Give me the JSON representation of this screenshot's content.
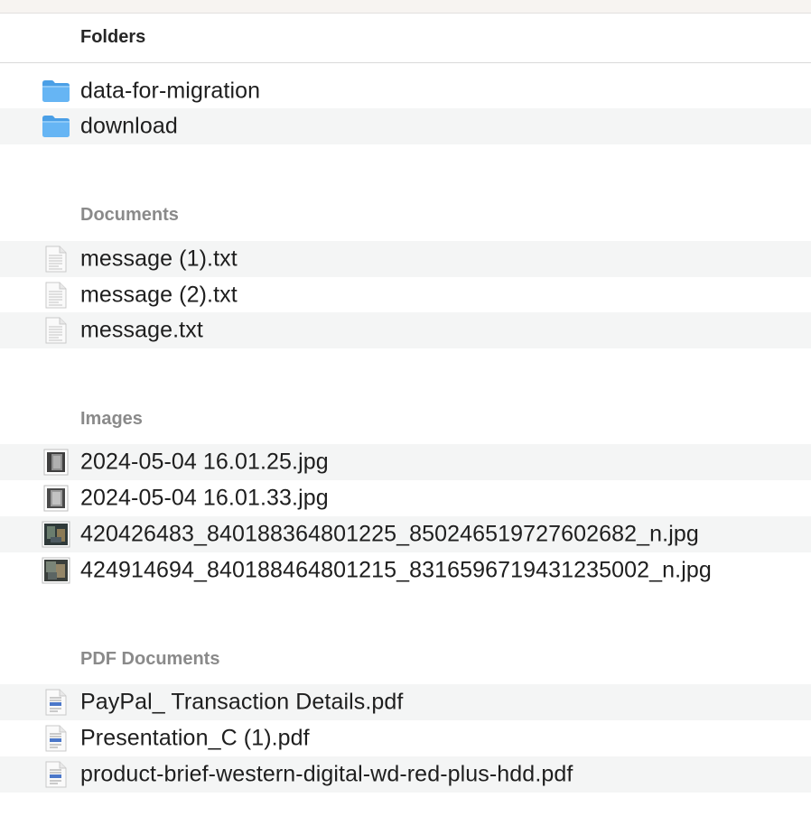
{
  "header": {
    "title": "Folders"
  },
  "sections": {
    "folders": {
      "items": [
        {
          "name": "data-for-migration",
          "icon": "folder-icon"
        },
        {
          "name": "download",
          "icon": "folder-icon"
        }
      ]
    },
    "documents": {
      "title": "Documents",
      "items": [
        {
          "name": "message (1).txt",
          "icon": "text-file-icon"
        },
        {
          "name": "message (2).txt",
          "icon": "text-file-icon"
        },
        {
          "name": "message.txt",
          "icon": "text-file-icon"
        }
      ]
    },
    "images": {
      "title": "Images",
      "items": [
        {
          "name": "2024-05-04 16.01.25.jpg",
          "icon": "image-thumbnail-icon"
        },
        {
          "name": "2024-05-04 16.01.33.jpg",
          "icon": "image-thumbnail-icon"
        },
        {
          "name": "420426483_840188364801225_850246519727602682_n.jpg",
          "icon": "image-thumbnail-icon"
        },
        {
          "name": "424914694_840188464801215_8316596719431235002_n.jpg",
          "icon": "image-thumbnail-icon"
        }
      ]
    },
    "pdfs": {
      "title": "PDF Documents",
      "items": [
        {
          "name": "PayPal_ Transaction Details.pdf",
          "icon": "pdf-file-icon"
        },
        {
          "name": "Presentation_C (1).pdf",
          "icon": "pdf-file-icon"
        },
        {
          "name": "product-brief-western-digital-wd-red-plus-hdd.pdf",
          "icon": "pdf-file-icon"
        }
      ]
    }
  },
  "colors": {
    "folder_blue": "#5aaef0",
    "row_alt": "#f4f5f5",
    "section_title": "#8a8a8a"
  }
}
